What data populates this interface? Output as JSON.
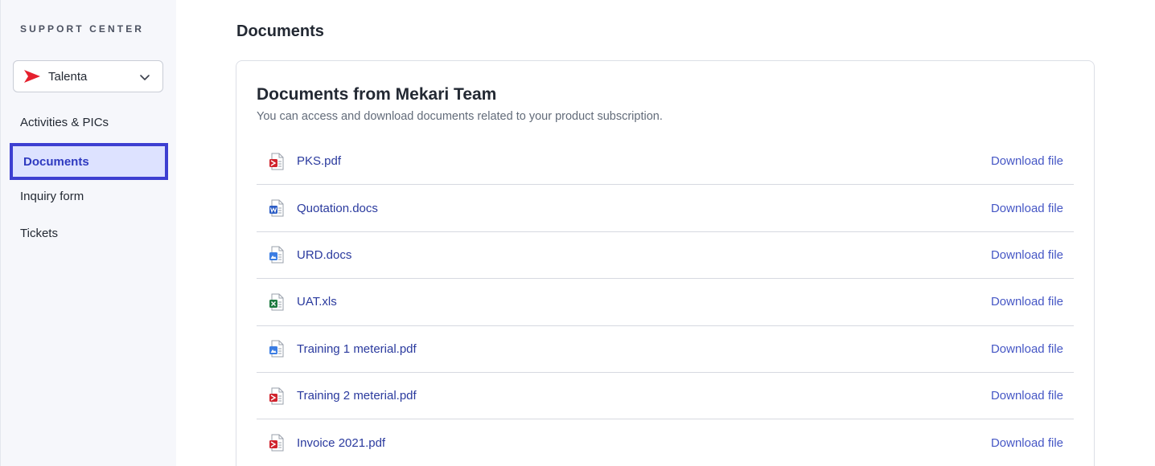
{
  "sidebar": {
    "title": "SUPPORT CENTER",
    "product_selector": {
      "value": "Talenta",
      "logo_icon": "talenta-logo-icon",
      "brand_color": "#e5202e"
    },
    "items": [
      {
        "label": "Activities & PICs",
        "active": false
      },
      {
        "label": "Documents",
        "active": true
      },
      {
        "label": "Inquiry form",
        "active": false
      },
      {
        "label": "Tickets",
        "active": false
      }
    ]
  },
  "main": {
    "page_title": "Documents",
    "card": {
      "title": "Documents from Mekari Team",
      "subtitle": "You can access and download documents related to your product subscription.",
      "documents": [
        {
          "name": "PKS.pdf",
          "icon": "pdf-file-icon",
          "action": "Download file"
        },
        {
          "name": "Quotation.docs",
          "icon": "word-file-icon",
          "action": "Download file"
        },
        {
          "name": "URD.docs",
          "icon": "image-file-icon",
          "action": "Download file"
        },
        {
          "name": "UAT.xls",
          "icon": "excel-file-icon",
          "action": "Download file"
        },
        {
          "name": "Training 1 meterial.pdf",
          "icon": "image-file-icon",
          "action": "Download file"
        },
        {
          "name": "Training 2 meterial.pdf",
          "icon": "pdf-file-icon",
          "action": "Download file"
        },
        {
          "name": "Invoice 2021.pdf",
          "icon": "pdf-file-icon",
          "action": "Download file"
        }
      ]
    }
  },
  "colors": {
    "accent": "#3d3fd1",
    "active_bg": "#dde2ff",
    "link": "#4657c5",
    "pdf": "#d0232d",
    "word": "#2b5cc5",
    "excel": "#1d7a40",
    "image": "#3b7de3"
  }
}
